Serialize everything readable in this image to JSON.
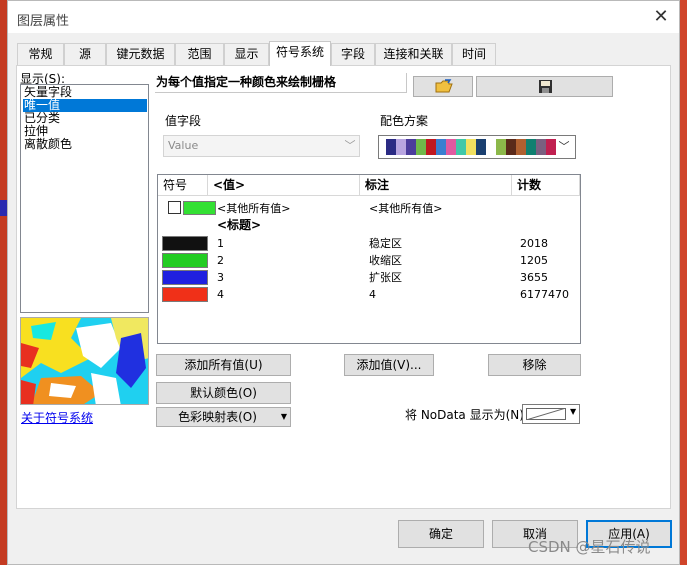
{
  "window": {
    "title": "图层属性",
    "close": "✕"
  },
  "tabs": [
    {
      "label": "常规",
      "active": false
    },
    {
      "label": "源",
      "active": false
    },
    {
      "label": "键元数据",
      "active": false
    },
    {
      "label": "范围",
      "active": false
    },
    {
      "label": "显示",
      "active": false
    },
    {
      "label": "符号系统",
      "active": true
    },
    {
      "label": "字段",
      "active": false
    },
    {
      "label": "连接和关联",
      "active": false
    },
    {
      "label": "时间",
      "active": false
    }
  ],
  "show": {
    "label": "显示(S):",
    "items": [
      {
        "label": "矢量字段",
        "selected": false
      },
      {
        "label": "唯一值",
        "selected": true
      },
      {
        "label": "已分类",
        "selected": false
      },
      {
        "label": "拉伸",
        "selected": false
      },
      {
        "label": "离散颜色",
        "selected": false
      }
    ]
  },
  "about_link": "关于符号系统",
  "symbology": {
    "heading": "为每个值指定一种颜色来绘制栅格",
    "toolbar_icons": [
      "open-folder-icon",
      "save-disk-icon"
    ],
    "value_field": {
      "label": "值字段",
      "value": "Value"
    },
    "color_ramp": {
      "label": "配色方案",
      "colors": [
        "#2b2b84",
        "#b8a5e0",
        "#4b3c9c",
        "#70b84a",
        "#c01820",
        "#3a7fd0",
        "#e05aa0",
        "#40c8a8",
        "#f0e060",
        "#1a4070",
        "#ffffff",
        "#8cb84a",
        "#5a2a1a",
        "#b06030",
        "#108070",
        "#7a6080",
        "#c02050"
      ]
    },
    "table": {
      "headers": {
        "symbol": "符号",
        "value": "<值>",
        "label": "标注",
        "count": "计数"
      },
      "other": {
        "value": "<其他所有值>",
        "label": "<其他所有值>",
        "color": "#33e033"
      },
      "heading_row": "<标题>",
      "rows": [
        {
          "value": "1",
          "label": "稳定区",
          "count": "2018",
          "color": "#111111"
        },
        {
          "value": "2",
          "label": "收缩区",
          "count": "1205",
          "color": "#22cc22"
        },
        {
          "value": "3",
          "label": "扩张区",
          "count": "3655",
          "color": "#2020e0"
        },
        {
          "value": "4",
          "label": "4",
          "count": "6177470",
          "color": "#f03018"
        }
      ]
    },
    "buttons": {
      "add_all": "添加所有值(U)",
      "add_value": "添加值(V)...",
      "remove": "移除",
      "default_colors": "默认颜色(O)",
      "colormap": "色彩映射表(O)"
    },
    "nodata_label": "将 NoData 显示为(N)"
  },
  "dialog_buttons": {
    "ok": "确定",
    "cancel": "取消",
    "apply": "应用(A)"
  },
  "watermark": "CSDN @星石传说"
}
